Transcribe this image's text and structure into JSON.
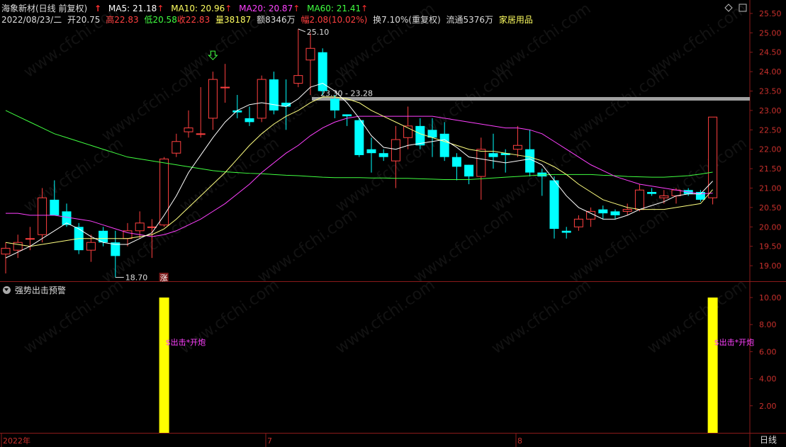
{
  "header": {
    "stock_name": "海象新材(日线 前复权)",
    "up_arrow": "↑",
    "ma5_label": "MA5: 21.18",
    "ma10_label": "MA10: 20.96",
    "ma20_label": "MA20: 20.87",
    "ma60_label": "MA60: 21.41",
    "arrow": "↑",
    "date": "2022/08/23/二",
    "open_label": "开",
    "open": "20.75",
    "high_label": "高",
    "high": "22.83",
    "low_label": "低",
    "low": "20.58",
    "close_label": "收",
    "close": "22.83",
    "volume_label": "量",
    "volume": "38187",
    "amount_label": "额",
    "amount": "8346万",
    "change_label": "幅",
    "change": "2.08(10.02%)",
    "turnover": "换7.10%(重复权)",
    "float": "流通5376万",
    "industry": "家居用品"
  },
  "colors": {
    "up": "#ff4040",
    "down": "#00ffff",
    "ma5": "#ffffff",
    "ma10": "#ffff80",
    "ma20": "#ff40ff",
    "ma60": "#40ff40",
    "axis": "#8b1a1a",
    "signal": "#ffff00",
    "signal_text": "#ff40ff",
    "ref_line": "#a0a0a0"
  },
  "chart_annotations": {
    "max_label": "25.10",
    "min_label": "18.70",
    "range_label": "23.30 - 23.28",
    "limit_badge": "涨",
    "signal_text": "$出击*开炮"
  },
  "price_axis": {
    "ticks": [
      "25.50",
      "25.00",
      "24.50",
      "24.00",
      "23.50",
      "23.00",
      "22.50",
      "22.00",
      "21.50",
      "21.00",
      "20.50",
      "20.00",
      "19.50",
      "19.00"
    ],
    "min": 18.6,
    "max": 25.7
  },
  "indicator": {
    "title": "强势出击预警",
    "ticks": [
      "10.00",
      "8.00",
      "6.00",
      "4.00",
      "2.00"
    ],
    "max": 10.0
  },
  "x_axis": {
    "labels": [
      "2022年",
      "7",
      "8"
    ]
  },
  "period_tab": "日线",
  "watermark": "www.cfchi.com",
  "chart_data": {
    "type": "candlestick",
    "x_index": [
      0,
      1,
      2,
      3,
      4,
      5,
      6,
      7,
      8,
      9,
      10,
      11,
      12,
      13,
      14,
      15,
      16,
      17,
      18,
      19,
      20,
      21,
      22,
      23,
      24,
      25,
      26,
      27,
      28,
      29,
      30,
      31,
      32,
      33,
      34,
      35,
      36,
      37,
      38,
      39,
      40,
      41,
      42,
      43,
      44,
      45,
      46,
      47,
      48,
      49,
      50,
      51,
      52,
      53,
      54,
      55,
      56,
      57,
      58
    ],
    "ohlc": [
      [
        19.3,
        19.6,
        18.8,
        19.45
      ],
      [
        19.4,
        19.8,
        19.2,
        19.6
      ],
      [
        19.7,
        20.0,
        19.4,
        19.7
      ],
      [
        19.8,
        21.0,
        19.6,
        20.75
      ],
      [
        20.7,
        21.2,
        20.4,
        20.3
      ],
      [
        20.4,
        20.6,
        20.0,
        20.05
      ],
      [
        20.0,
        20.1,
        19.3,
        19.4
      ],
      [
        19.4,
        19.8,
        19.1,
        19.6
      ],
      [
        19.9,
        20.0,
        19.5,
        19.6
      ],
      [
        19.6,
        19.9,
        18.7,
        19.25
      ],
      [
        19.7,
        20.1,
        19.5,
        19.9
      ],
      [
        19.9,
        20.4,
        19.7,
        20.1
      ],
      [
        20.0,
        20.2,
        19.2,
        20.0
      ],
      [
        20.05,
        21.8,
        20.0,
        21.75
      ],
      [
        21.9,
        22.4,
        21.8,
        22.2
      ],
      [
        22.45,
        23.0,
        22.3,
        22.55
      ],
      [
        22.4,
        23.6,
        22.3,
        22.4
      ],
      [
        22.8,
        24.0,
        22.5,
        23.8
      ],
      [
        23.6,
        24.2,
        23.2,
        23.6
      ],
      [
        23.0,
        23.4,
        22.8,
        22.95
      ],
      [
        22.8,
        23.1,
        22.6,
        22.7
      ],
      [
        22.8,
        23.9,
        22.7,
        23.8
      ],
      [
        23.8,
        24.0,
        22.9,
        23.0
      ],
      [
        23.2,
        23.8,
        22.5,
        23.1
      ],
      [
        23.7,
        25.1,
        23.6,
        23.9
      ],
      [
        24.3,
        25.0,
        23.4,
        24.6
      ],
      [
        24.5,
        24.6,
        23.4,
        23.5
      ],
      [
        23.3,
        23.4,
        22.8,
        23.0
      ],
      [
        22.9,
        22.9,
        22.6,
        22.85
      ],
      [
        22.75,
        22.8,
        21.8,
        21.85
      ],
      [
        22.0,
        22.3,
        21.4,
        21.9
      ],
      [
        21.9,
        22.0,
        21.7,
        21.8
      ],
      [
        21.7,
        22.6,
        21.0,
        22.25
      ],
      [
        22.3,
        23.1,
        22.0,
        22.6
      ],
      [
        22.6,
        22.8,
        22.0,
        22.1
      ],
      [
        22.5,
        22.8,
        21.8,
        22.3
      ],
      [
        22.4,
        22.7,
        21.7,
        21.8
      ],
      [
        21.8,
        21.9,
        21.2,
        21.55
      ],
      [
        21.6,
        21.6,
        21.1,
        21.3
      ],
      [
        21.3,
        22.3,
        20.7,
        22.0
      ],
      [
        21.9,
        22.4,
        21.5,
        21.8
      ],
      [
        21.9,
        22.0,
        21.4,
        21.85
      ],
      [
        22.0,
        22.6,
        21.8,
        22.1
      ],
      [
        22.0,
        22.5,
        21.3,
        21.4
      ],
      [
        21.4,
        21.5,
        20.8,
        21.3
      ],
      [
        21.2,
        21.3,
        19.7,
        19.95
      ],
      [
        19.9,
        20.0,
        19.7,
        19.85
      ],
      [
        20.0,
        20.3,
        19.9,
        20.2
      ],
      [
        20.2,
        20.5,
        20.0,
        20.4
      ],
      [
        20.45,
        20.55,
        20.2,
        20.35
      ],
      [
        20.4,
        20.45,
        20.2,
        20.3
      ],
      [
        20.4,
        20.6,
        20.3,
        20.45
      ],
      [
        20.45,
        21.1,
        20.4,
        20.95
      ],
      [
        20.9,
        21.0,
        20.8,
        20.85
      ],
      [
        20.75,
        20.95,
        20.6,
        20.8
      ],
      [
        20.8,
        21.0,
        20.6,
        20.95
      ],
      [
        20.95,
        21.0,
        20.8,
        20.85
      ],
      [
        20.9,
        20.95,
        20.65,
        20.7
      ],
      [
        20.75,
        22.83,
        20.58,
        22.83
      ]
    ],
    "ma5": [
      19.2,
      19.35,
      19.5,
      19.7,
      19.9,
      20.1,
      19.95,
      19.75,
      19.6,
      19.55,
      19.55,
      19.7,
      19.85,
      20.3,
      20.8,
      21.4,
      21.85,
      22.3,
      22.7,
      23.0,
      23.15,
      23.2,
      23.15,
      23.1,
      23.3,
      23.6,
      23.7,
      23.5,
      23.2,
      22.8,
      22.35,
      22.05,
      22.0,
      22.1,
      22.15,
      22.2,
      22.25,
      22.05,
      21.8,
      21.75,
      21.7,
      21.65,
      21.7,
      21.75,
      21.6,
      21.2,
      20.8,
      20.5,
      20.35,
      20.2,
      20.2,
      20.3,
      20.45,
      20.55,
      20.65,
      20.8,
      20.85,
      20.85,
      21.18
    ],
    "ma10": [
      19.6,
      19.55,
      19.5,
      19.55,
      19.6,
      19.65,
      19.7,
      19.7,
      19.7,
      19.7,
      19.7,
      19.75,
      19.8,
      19.95,
      20.2,
      20.5,
      20.8,
      21.1,
      21.4,
      21.75,
      22.1,
      22.4,
      22.65,
      22.85,
      23.0,
      23.2,
      23.35,
      23.35,
      23.3,
      23.2,
      23.0,
      22.85,
      22.7,
      22.55,
      22.4,
      22.3,
      22.2,
      22.1,
      22.0,
      21.95,
      21.95,
      21.9,
      21.85,
      21.8,
      21.7,
      21.55,
      21.35,
      21.1,
      20.9,
      20.7,
      20.6,
      20.5,
      20.45,
      20.45,
      20.45,
      20.5,
      20.55,
      20.6,
      20.96
    ],
    "ma20": [
      20.35,
      20.35,
      20.3,
      20.3,
      20.3,
      20.25,
      20.2,
      20.15,
      20.05,
      19.95,
      19.85,
      19.8,
      19.75,
      19.8,
      19.9,
      20.05,
      20.2,
      20.4,
      20.6,
      20.85,
      21.1,
      21.4,
      21.65,
      21.9,
      22.1,
      22.35,
      22.55,
      22.7,
      22.8,
      22.85,
      22.85,
      22.85,
      22.85,
      22.85,
      22.85,
      22.85,
      22.8,
      22.75,
      22.7,
      22.65,
      22.6,
      22.55,
      22.55,
      22.5,
      22.4,
      22.2,
      22.0,
      21.8,
      21.6,
      21.45,
      21.3,
      21.2,
      21.1,
      21.05,
      21.0,
      20.95,
      20.9,
      20.85,
      20.87
    ],
    "ma60": [
      23.0,
      22.85,
      22.7,
      22.55,
      22.4,
      22.3,
      22.2,
      22.1,
      22.0,
      21.9,
      21.8,
      21.75,
      21.7,
      21.65,
      21.6,
      21.55,
      21.5,
      21.45,
      21.42,
      21.4,
      21.38,
      21.37,
      21.35,
      21.33,
      21.32,
      21.3,
      21.28,
      21.27,
      21.27,
      21.27,
      21.26,
      21.26,
      21.25,
      21.25,
      21.24,
      21.23,
      21.22,
      21.22,
      21.22,
      21.24,
      21.26,
      21.28,
      21.3,
      21.32,
      21.34,
      21.35,
      21.35,
      21.35,
      21.35,
      21.33,
      21.32,
      21.3,
      21.29,
      21.28,
      21.28,
      21.3,
      21.32,
      21.36,
      21.41
    ],
    "signal_bars": [
      13,
      58
    ],
    "signal_value": 10.0
  }
}
